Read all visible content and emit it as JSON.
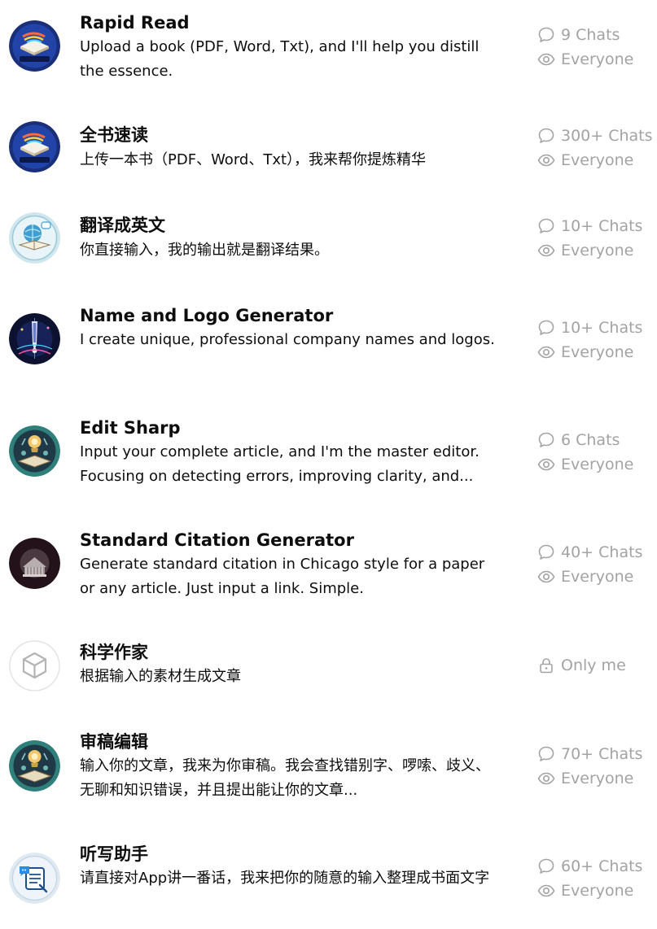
{
  "gpts": [
    {
      "title": "Rapid Read",
      "description": "Upload a book (PDF, Word, Txt), and I'll help you distill the essence.",
      "chats": "9 Chats",
      "visibility": "Everyone",
      "avatar": "book-brand-avatar",
      "avatar_label": "RapidRead"
    },
    {
      "title": "全书速读",
      "description": "上传一本书（PDF、Word、Txt），我来帮你提炼精华",
      "chats": "300+ Chats",
      "visibility": "Everyone",
      "avatar": "book-brand-avatar",
      "avatar_label": "RapidRead"
    },
    {
      "title": "翻译成英文",
      "description": "你直接输入，我的输出就是翻译结果。",
      "chats": "10+ Chats",
      "visibility": "Everyone",
      "avatar": "globe-book-avatar"
    },
    {
      "title": "Name and Logo Generator",
      "description": "I create unique, professional company names and logos.",
      "chats": "10+ Chats",
      "visibility": "Everyone",
      "avatar": "pen-light-avatar"
    },
    {
      "title": "Edit Sharp",
      "description": "Input your complete article, and I'm the master editor. Focusing on detecting errors, improving clarity, and...",
      "chats": "6 Chats",
      "visibility": "Everyone",
      "avatar": "editor-desk-avatar"
    },
    {
      "title": "Standard Citation Generator",
      "description": "Generate standard citation in Chicago style for a paper or any article. Just input a link. Simple.",
      "chats": "40+ Chats",
      "visibility": "Everyone",
      "avatar": "library-avatar"
    },
    {
      "title": "科学作家",
      "description": "根据输入的素材生成文章",
      "visibility": "Only me",
      "avatar": "cube-placeholder-avatar"
    },
    {
      "title": "审稿编辑",
      "description": "输入你的文章，我来为你审稿。我会查找错别字、啰嗦、歧义、无聊和知识错误，并且提出能让你的文章...",
      "chats": "70+ Chats",
      "visibility": "Everyone",
      "avatar": "editor-desk-avatar"
    },
    {
      "title": "听写助手",
      "description": "请直接对App讲一番话，我来把你的随意的输入整理成书面文字",
      "chats": "60+ Chats",
      "visibility": "Everyone",
      "avatar": "dictation-avatar"
    }
  ],
  "colors": {
    "title": "#0d0d0d",
    "description": "#0d0d0d",
    "meta": "#a3a3a3",
    "background": "#ffffff"
  }
}
